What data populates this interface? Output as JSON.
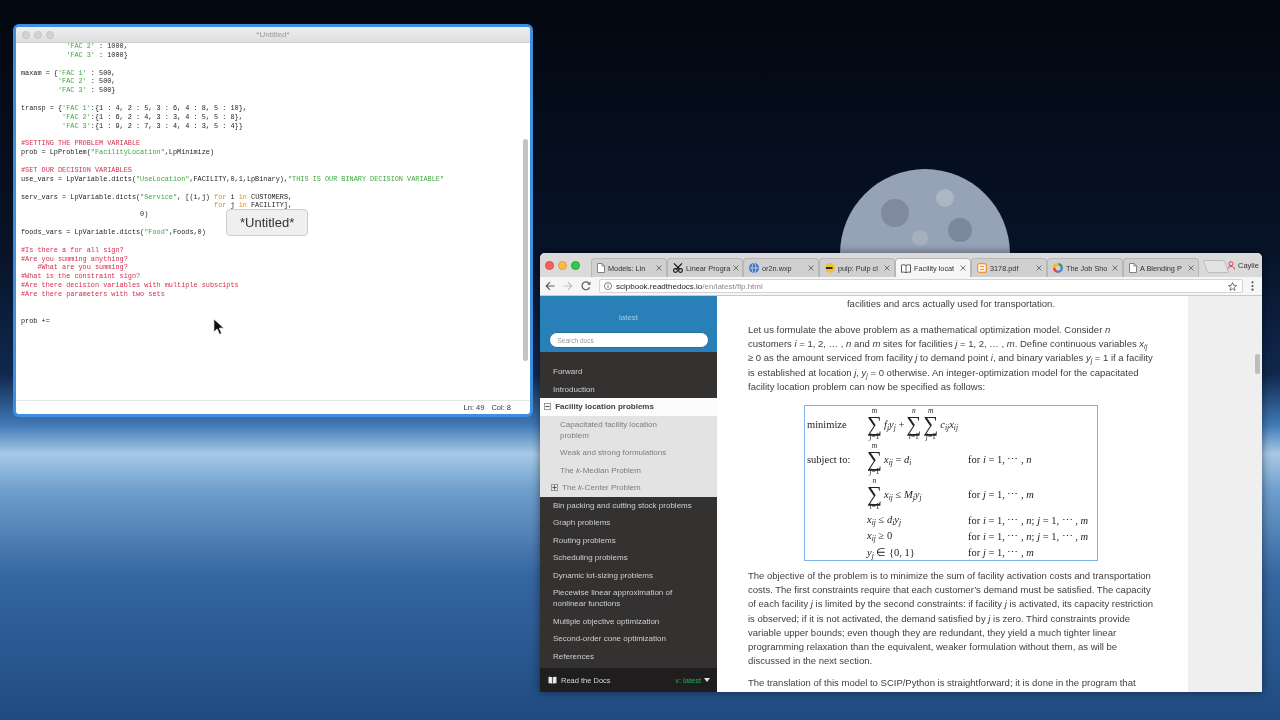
{
  "editor": {
    "title": "*Untitled*",
    "code_lines": [
      {
        "kind": "code",
        "tokens": [
          {
            "kind": "string",
            "text": "           'FAC 2'"
          },
          {
            "kind": "plain",
            "text": " : 1000,"
          }
        ]
      },
      {
        "kind": "code",
        "tokens": [
          {
            "kind": "string",
            "text": "           'FAC 3'"
          },
          {
            "kind": "plain",
            "text": " : 1000}"
          }
        ]
      },
      {
        "kind": "blank"
      },
      {
        "kind": "code",
        "tokens": [
          {
            "kind": "plain",
            "text": "maxam = {"
          },
          {
            "kind": "string",
            "text": "'FAC 1'"
          },
          {
            "kind": "plain",
            "text": " : 500,"
          }
        ]
      },
      {
        "kind": "code",
        "tokens": [
          {
            "kind": "string",
            "text": "         'FAC 2'"
          },
          {
            "kind": "plain",
            "text": " : 500,"
          }
        ]
      },
      {
        "kind": "code",
        "tokens": [
          {
            "kind": "string",
            "text": "         'FAC 3'"
          },
          {
            "kind": "plain",
            "text": " : 500}"
          }
        ]
      },
      {
        "kind": "blank"
      },
      {
        "kind": "code",
        "tokens": [
          {
            "kind": "plain",
            "text": "transp = {"
          },
          {
            "kind": "string",
            "text": "'FAC 1'"
          },
          {
            "kind": "plain",
            "text": ":{1 : 4, 2 : 5, 3 : 6, 4 : 8, 5 : 10},"
          }
        ]
      },
      {
        "kind": "code",
        "tokens": [
          {
            "kind": "string",
            "text": "          'FAC 2'"
          },
          {
            "kind": "plain",
            "text": ":{1 : 6, 2 : 4, 3 : 3, 4 : 5, 5 : 8},"
          }
        ]
      },
      {
        "kind": "code",
        "tokens": [
          {
            "kind": "string",
            "text": "          'FAC 3'"
          },
          {
            "kind": "plain",
            "text": ":{1 : 9, 2 : 7, 3 : 4, 4 : 3, 5 : 4}}"
          }
        ]
      },
      {
        "kind": "blank"
      },
      {
        "kind": "code",
        "tokens": [
          {
            "kind": "comment",
            "text": "#SETTING THE PROBLEM VARIABLE"
          }
        ]
      },
      {
        "kind": "code",
        "tokens": [
          {
            "kind": "plain",
            "text": "prob = LpProblem("
          },
          {
            "kind": "string",
            "text": "\"FacilityLocation\""
          },
          {
            "kind": "plain",
            "text": ",LpMinimize)"
          }
        ]
      },
      {
        "kind": "blank"
      },
      {
        "kind": "code",
        "tokens": [
          {
            "kind": "comment",
            "text": "#SET OUR DECISION VARIABLES"
          }
        ]
      },
      {
        "kind": "code",
        "tokens": [
          {
            "kind": "plain",
            "text": "use_vars = LpVariable.dicts("
          },
          {
            "kind": "string",
            "text": "\"UseLocation\""
          },
          {
            "kind": "plain",
            "text": ",FACILITY,0,1,LpBinary),"
          },
          {
            "kind": "string",
            "text": "\"THIS IS OUR BINARY DECISION VARIABLE\""
          }
        ]
      },
      {
        "kind": "blank"
      },
      {
        "kind": "code",
        "tokens": [
          {
            "kind": "plain",
            "text": "serv_vars = LpVariable.dicts("
          },
          {
            "kind": "string",
            "text": "\"Service\""
          },
          {
            "kind": "plain",
            "text": ", [(i,j) "
          },
          {
            "kind": "keyword",
            "text": "for"
          },
          {
            "kind": "plain",
            "text": " i "
          },
          {
            "kind": "keyword",
            "text": "in"
          },
          {
            "kind": "plain",
            "text": " CUSTOMERS,"
          }
        ]
      },
      {
        "kind": "code",
        "tokens": [
          {
            "kind": "keyword",
            "text": "                                               for"
          },
          {
            "kind": "plain",
            "text": " j "
          },
          {
            "kind": "keyword",
            "text": "in"
          },
          {
            "kind": "plain",
            "text": " FACILITY],"
          }
        ]
      },
      {
        "kind": "code",
        "tokens": [
          {
            "kind": "plain",
            "text": "                             0)"
          }
        ]
      },
      {
        "kind": "blank"
      },
      {
        "kind": "code",
        "tokens": [
          {
            "kind": "plain",
            "text": "foods_vars = LpVariable.dicts("
          },
          {
            "kind": "string",
            "text": "\"Food\""
          },
          {
            "kind": "plain",
            "text": ",Foods,0)"
          }
        ]
      },
      {
        "kind": "blank"
      },
      {
        "kind": "code",
        "tokens": [
          {
            "kind": "comment",
            "text": "#Is there a for all sign?"
          }
        ]
      },
      {
        "kind": "code",
        "tokens": [
          {
            "kind": "comment",
            "text": "#Are you summing anything?"
          }
        ]
      },
      {
        "kind": "code",
        "tokens": [
          {
            "kind": "comment",
            "text": "    #What are you summing?"
          }
        ]
      },
      {
        "kind": "code",
        "tokens": [
          {
            "kind": "comment",
            "text": "#What is the constraint sign?"
          }
        ]
      },
      {
        "kind": "code",
        "tokens": [
          {
            "kind": "comment",
            "text": "#Are there decision variables with multiple subscipts"
          }
        ]
      },
      {
        "kind": "code",
        "tokens": [
          {
            "kind": "comment",
            "text": "#Are there parameters with two sets"
          }
        ]
      },
      {
        "kind": "blank"
      },
      {
        "kind": "blank"
      },
      {
        "kind": "code",
        "tokens": [
          {
            "kind": "plain",
            "text": "prob +="
          }
        ]
      }
    ],
    "tooltip": "*Untitled*",
    "status": {
      "line": "Ln: 49",
      "column": "Col: 8"
    }
  },
  "browser": {
    "tabs": [
      {
        "title": "Models: Lin",
        "kind": "document",
        "selected": false
      },
      {
        "title": "Linear Progra",
        "kind": "scissors",
        "selected": false
      },
      {
        "title": "or2n.wxp",
        "kind": "globe",
        "selected": false
      },
      {
        "title": "pulp: Pulp cl",
        "kind": "disc",
        "selected": false
      },
      {
        "title": "Facility locat",
        "kind": "book",
        "selected": true
      },
      {
        "title": "3178.pdf",
        "kind": "file",
        "selected": false
      },
      {
        "title": "The Job Sho",
        "kind": "ring",
        "selected": false
      },
      {
        "title": "A Blending P",
        "kind": "document",
        "selected": false
      }
    ],
    "profile": "Caylie",
    "back": {
      "disabled": false
    },
    "forward": {
      "disabled": true
    },
    "address": {
      "domain": "scipbook.readthedocs.io",
      "path": "/en/latest/flp.html"
    },
    "sidebar": {
      "version_title": "latest",
      "search": {
        "placeholder": "Search docs"
      },
      "nav": [
        {
          "label": "Forward",
          "selected": false
        },
        {
          "label": "Introduction",
          "selected": false
        },
        {
          "label": "Facility location problems",
          "selected": true,
          "expanded": true,
          "children": [
            {
              "label": "Capacitated facility location problem",
              "selected": false
            },
            {
              "label": "Weak and strong formulations",
              "selected": false
            },
            {
              "label": "The *k*-Median Problem",
              "selected": false
            },
            {
              "label": "The *k*-Center Problem",
              "selected": false,
              "expanded": false
            }
          ]
        },
        {
          "label": "Bin packing and cutting stock problems",
          "selected": false
        },
        {
          "label": "Graph problems",
          "selected": false
        },
        {
          "label": "Routing problems",
          "selected": false
        },
        {
          "label": "Scheduling problems",
          "selected": false
        },
        {
          "label": "Dynamic lot-sizing problems",
          "selected": false
        },
        {
          "label": "Piecewise linear approximation of nonlinear functions",
          "selected": false
        },
        {
          "label": "Multiple objective optimization",
          "selected": false
        },
        {
          "label": "Second-order cone optimization",
          "selected": false
        },
        {
          "label": "References",
          "selected": false
        }
      ],
      "footer": {
        "brand": "Read the Docs",
        "version": "v: latest"
      }
    },
    "content": {
      "caption": "facilities and arcs actually used for transportation.",
      "intro": "Let us formulate the above problem as a mathematical optimization model. Consider *n* customers *i* = 1, 2, … , *n* and *m* sites for facilities *j* = 1, 2, … , *m*. Define continuous variables *x*$_{ij}$ ≥ 0 as the amount serviced from facility *j* to demand point *i*, and binary variables *y*$_{j}$ = 1 if a facility is established at location *j*, *y*$_{j}$ = 0 otherwise. An integer-optimization model for the capacitated facility location problem can now be specified as follows:",
      "formula": {
        "rows": [
          {
            "label": "minimize",
            "terms": [
              {
                "kind": "sum",
                "symbol": "∑",
                "upper": "m",
                "lower": "*j*=1"
              },
              {
                "kind": "text",
                "text": "*f*$_{j}$*y*$_{j}$ +"
              },
              {
                "kind": "sum",
                "symbol": "∑",
                "upper": "n",
                "lower": "*i*=1"
              },
              {
                "kind": "sum",
                "symbol": "∑",
                "upper": "m",
                "lower": "*j*=1"
              },
              {
                "kind": "text",
                "text": "*c*$_{ij}$*x*$_{ij}$"
              }
            ]
          },
          {
            "label": "subject to:",
            "terms": [
              {
                "kind": "sum",
                "symbol": "∑",
                "upper": "m",
                "lower": "*j*=1"
              },
              {
                "kind": "text",
                "text": "*x*$_{ij}$ = *d*$_{i}$"
              }
            ],
            "condition": "for *i* = 1, ⋯ , *n*"
          },
          {
            "terms": [
              {
                "kind": "sum",
                "symbol": "∑",
                "upper": "n",
                "lower": "*i*=1"
              },
              {
                "kind": "text",
                "text": "*x*$_{ij}$ ≤ *M*$_{j}$*y*$_{j}$"
              }
            ],
            "condition": "for *j* = 1, ⋯ , *m*"
          },
          {
            "terms": [
              {
                "kind": "text",
                "text": "*x*$_{ij}$ ≤ *d*$_{i}$*y*$_{j}$"
              }
            ],
            "condition": "for *i* = 1, ⋯ , *n*; *j* = 1, ⋯ , *m*"
          },
          {
            "terms": [
              {
                "kind": "text",
                "text": "*x*$_{ij}$ ≥ 0"
              }
            ],
            "condition": "for *i* = 1, ⋯ , *n*; *j* = 1, ⋯ , *m*"
          },
          {
            "terms": [
              {
                "kind": "text",
                "text": "*y*$_{j}$ ∈ {0, 1}"
              }
            ],
            "condition": "for *j* = 1, ⋯ , *m*"
          }
        ]
      },
      "paragraphs": [
        "The objective of the problem is to minimize the sum of facility activation costs and transportation costs. The first constraints require that each customer’s demand must be satisfied. The capacity of each facility *j* is limited by the second constraints: if facility *j* is activated, its capacity restriction is observed; if it is not activated, the demand satisfied by *j* is zero. Third constraints provide variable upper bounds; even though they are redundant, they yield a much tighter linear programming relaxation than the equivalent, weaker formulation without them, as will be discussed in the next section.",
        "The translation of this model to SCIP/Python is straightforward; it is done in the program that"
      ]
    }
  }
}
